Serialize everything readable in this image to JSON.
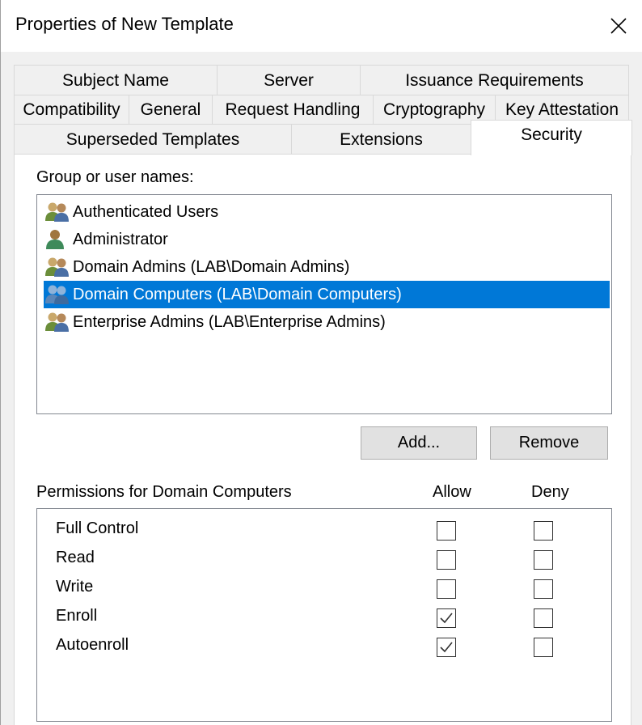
{
  "window": {
    "title": "Properties of New Template"
  },
  "tabs": {
    "row1": [
      "Subject Name",
      "Server",
      "Issuance Requirements"
    ],
    "row2": [
      "Compatibility",
      "General",
      "Request Handling",
      "Cryptography",
      "Key Attestation"
    ],
    "row3": [
      "Superseded Templates",
      "Extensions",
      "Security"
    ],
    "active": "Security"
  },
  "security": {
    "group_label": "Group or user names:",
    "groups": [
      {
        "name": "Authenticated Users",
        "icon": "users-group-icon",
        "selected": false
      },
      {
        "name": "Administrator",
        "icon": "user-icon",
        "selected": false
      },
      {
        "name": "Domain Admins (LAB\\Domain Admins)",
        "icon": "users-group-icon",
        "selected": false
      },
      {
        "name": "Domain Computers (LAB\\Domain Computers)",
        "icon": "users-group-icon",
        "selected": true
      },
      {
        "name": "Enterprise Admins (LAB\\Enterprise Admins)",
        "icon": "users-group-icon",
        "selected": false
      }
    ],
    "add_label": "Add...",
    "remove_label": "Remove",
    "permissions_label": "Permissions for Domain Computers",
    "allow_label": "Allow",
    "deny_label": "Deny",
    "permissions": [
      {
        "name": "Full Control",
        "allow": false,
        "deny": false
      },
      {
        "name": "Read",
        "allow": false,
        "deny": false
      },
      {
        "name": "Write",
        "allow": false,
        "deny": false
      },
      {
        "name": "Enroll",
        "allow": true,
        "deny": false
      },
      {
        "name": "Autoenroll",
        "allow": true,
        "deny": false
      }
    ]
  },
  "colors": {
    "selection": "#0078d7",
    "window_bg": "#f0f0f0",
    "panel_bg": "#ffffff"
  }
}
